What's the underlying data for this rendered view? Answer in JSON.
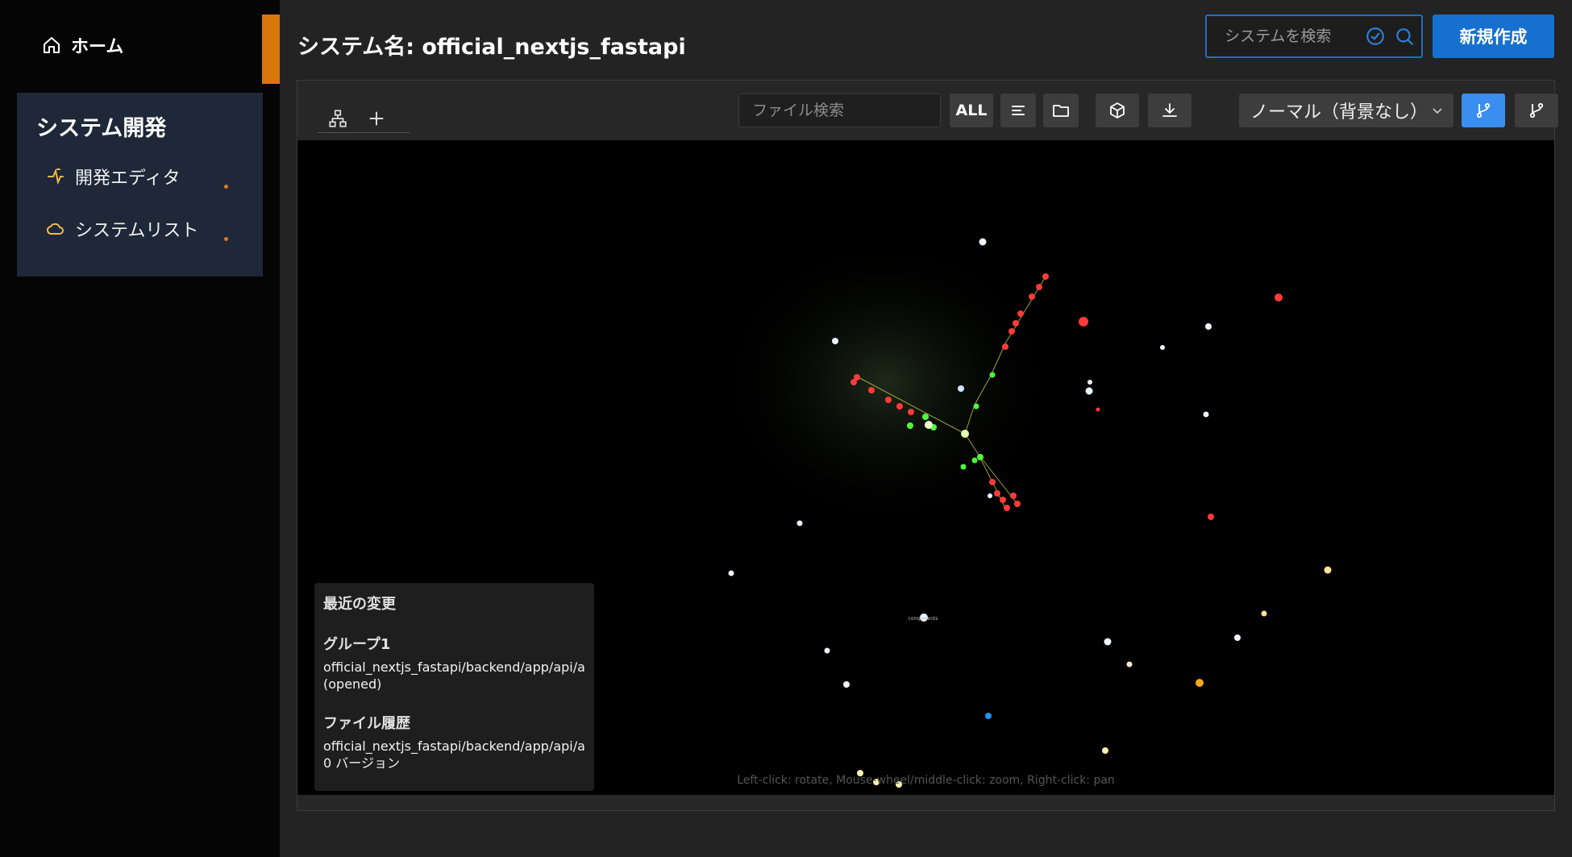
{
  "sidebar": {
    "home_label": "ホーム",
    "section_title": "システム開発",
    "items": [
      {
        "label": "開発エディタ",
        "icon": "dev-editor-icon"
      },
      {
        "label": "システムリスト",
        "icon": "cloud-icon"
      }
    ]
  },
  "header": {
    "title": "システム名: official_nextjs_fastapi",
    "search_placeholder": "システムを検索",
    "new_button": "新規作成"
  },
  "toolbar": {
    "file_search_placeholder": "ファイル検索",
    "all_label": "ALL",
    "mode_selected": "ノーマル（背景なし）"
  },
  "recent": {
    "title": "最近の変更",
    "group_title": "グループ1",
    "group_path": "official_nextjs_fastapi/backend/app/api/au",
    "group_status": "(opened)",
    "history_title": "ファイル履歴",
    "history_path": "official_nextjs_fastapi/backend/app/api/au",
    "history_version": "0 バージョン"
  },
  "canvas": {
    "hint": "Left-click: rotate, Mouse-wheel/middle-click: zoom, Right-click: pan",
    "labels": [
      "components"
    ]
  },
  "colors": {
    "accent": "#1670d0",
    "orange": "#d9770a",
    "red_node": "#ff3333",
    "green_node": "#4cff3a",
    "white_node": "#eef6ff"
  }
}
